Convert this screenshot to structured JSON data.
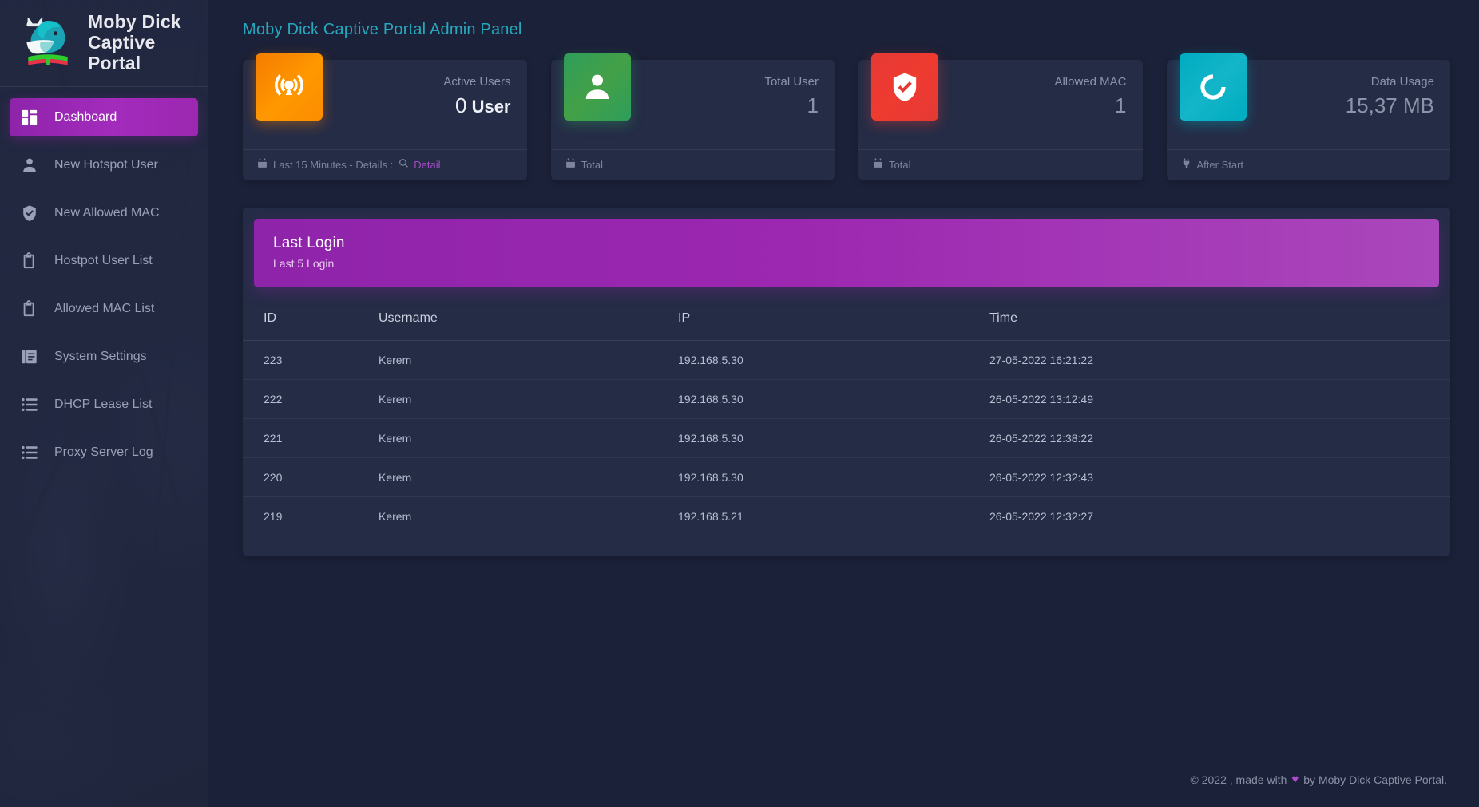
{
  "brand": {
    "line1": "Moby Dick",
    "line2": "Captive Portal",
    "logo_icon": "whale-book-logo"
  },
  "sidebar": {
    "items": [
      {
        "label": "Dashboard",
        "icon": "dashboard-grid-icon",
        "active": true
      },
      {
        "label": "New Hotspot User",
        "icon": "person-icon",
        "active": false
      },
      {
        "label": "New Allowed MAC",
        "icon": "shield-check-icon",
        "active": false
      },
      {
        "label": "Hostpot User List",
        "icon": "clipboard-icon",
        "active": false
      },
      {
        "label": "Allowed MAC List",
        "icon": "clipboard-icon",
        "active": false
      },
      {
        "label": "System Settings",
        "icon": "documents-icon",
        "active": false
      },
      {
        "label": "DHCP Lease List",
        "icon": "list-icon",
        "active": false
      },
      {
        "label": "Proxy Server Log",
        "icon": "list-icon",
        "active": false
      }
    ]
  },
  "header": {
    "title": "Moby Dick Captive Portal Admin Panel"
  },
  "cards": [
    {
      "label": "Active Users",
      "value": "0",
      "unit": " User",
      "icon": "broadcast-signal-icon",
      "icon_class": "icon-orange",
      "accent": "#f57c00",
      "foot_icon": "calendar-icon",
      "foot_text": "Last 15 Minutes - Details :",
      "foot_link_icon": "search-icon",
      "foot_link": "Detail",
      "bright": true
    },
    {
      "label": "Total User",
      "value": "1",
      "unit": "",
      "icon": "person-icon",
      "icon_class": "icon-green",
      "accent": "#43a047",
      "foot_icon": "calendar-icon",
      "foot_text": "Total",
      "foot_link_icon": "",
      "foot_link": "",
      "bright": false
    },
    {
      "label": "Allowed MAC",
      "value": "1",
      "unit": "",
      "icon": "shield-check-icon",
      "icon_class": "icon-red",
      "accent": "#e53935",
      "foot_icon": "calendar-icon",
      "foot_text": "Total",
      "foot_link_icon": "",
      "foot_link": "",
      "bright": false
    },
    {
      "label": "Data Usage",
      "value": "15,37 MB",
      "unit": "",
      "icon": "data-circle-icon",
      "icon_class": "icon-cyan",
      "accent": "#00acc1",
      "foot_icon": "plug-icon",
      "foot_text": "After Start",
      "foot_link_icon": "",
      "foot_link": "",
      "bright": false
    }
  ],
  "panel": {
    "title": "Last Login",
    "subtitle": "Last 5 Login",
    "columns": [
      "ID",
      "Username",
      "IP",
      "Time"
    ],
    "rows": [
      {
        "id": "223",
        "username": "Kerem",
        "ip": "192.168.5.30",
        "time": "27-05-2022 16:21:22"
      },
      {
        "id": "222",
        "username": "Kerem",
        "ip": "192.168.5.30",
        "time": "26-05-2022 13:12:49"
      },
      {
        "id": "221",
        "username": "Kerem",
        "ip": "192.168.5.30",
        "time": "26-05-2022 12:38:22"
      },
      {
        "id": "220",
        "username": "Kerem",
        "ip": "192.168.5.30",
        "time": "26-05-2022 12:32:43"
      },
      {
        "id": "219",
        "username": "Kerem",
        "ip": "192.168.5.21",
        "time": "26-05-2022 12:32:27"
      }
    ]
  },
  "footer": {
    "prefix": "© 2022 , made with",
    "heart": "♥",
    "suffix": "by Moby Dick Captive Portal."
  },
  "colors": {
    "accent_title": "#27a8bd",
    "sidebar_active": "#9c27b0",
    "panel_header": "#9c27b0",
    "page_bg": "#1b2138",
    "card_bg": "#252c46"
  }
}
